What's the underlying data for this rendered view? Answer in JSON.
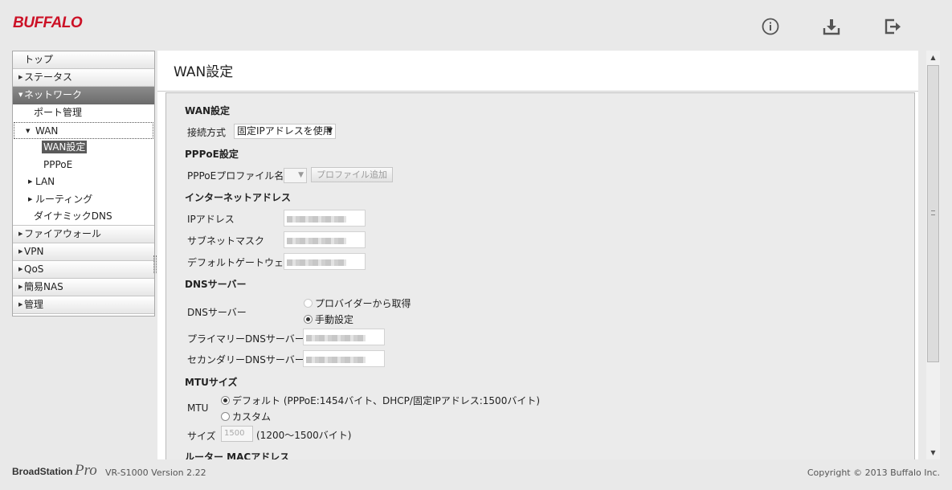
{
  "header": {
    "logo": "BUFFALO",
    "icons": [
      "info-icon",
      "download-icon",
      "logout-icon"
    ]
  },
  "sidebar": {
    "items": {
      "top": "トップ",
      "status": "ステータス",
      "network": "ネットワーク",
      "port": "ポート管理",
      "wan": "WAN",
      "wan_setting": "WAN設定",
      "pppoe": "PPPoE",
      "lan": "LAN",
      "routing": "ルーティング",
      "ddns": "ダイナミックDNS",
      "firewall": "ファイアウォール",
      "vpn": "VPN",
      "qos": "QoS",
      "nas": "簡易NAS",
      "admin": "管理"
    }
  },
  "main": {
    "title": "WAN設定",
    "wan": {
      "heading": "WAN設定",
      "conn_label": "接続方式",
      "conn_value": "固定IPアドレスを使用"
    },
    "pppoe": {
      "heading": "PPPoE設定",
      "profile_label": "PPPoEプロファイル名",
      "add_button": "プロファイル追加"
    },
    "internet": {
      "heading": "インターネットアドレス",
      "ip_label": "IPアドレス",
      "subnet_label": "サブネットマスク",
      "gateway_label": "デフォルトゲートウェイ"
    },
    "dns": {
      "heading": "DNSサーバー",
      "label": "DNSサーバー",
      "opt_provider": "プロバイダーから取得",
      "opt_manual": "手動設定",
      "primary_label": "プライマリーDNSサーバー",
      "secondary_label": "セカンダリーDNSサーバー"
    },
    "mtu": {
      "heading": "MTUサイズ",
      "label": "MTU",
      "opt_default": "デフォルト (PPPoE:1454バイト、DHCP/固定IPアドレス:1500バイト)",
      "opt_custom": "カスタム",
      "size_label": "サイズ",
      "size_placeholder": "1500",
      "size_range": "(1200～1500バイト)"
    },
    "router_mac": {
      "heading": "ルーター MACアドレス"
    }
  },
  "footer": {
    "brand": "BroadStation",
    "brand_suffix": "Pro",
    "version": "VR-S1000 Version 2.22",
    "copyright": "Copyright © 2013 Buffalo Inc."
  },
  "colors": {
    "brand_red": "#cc1126",
    "active_nav": "#777777"
  }
}
